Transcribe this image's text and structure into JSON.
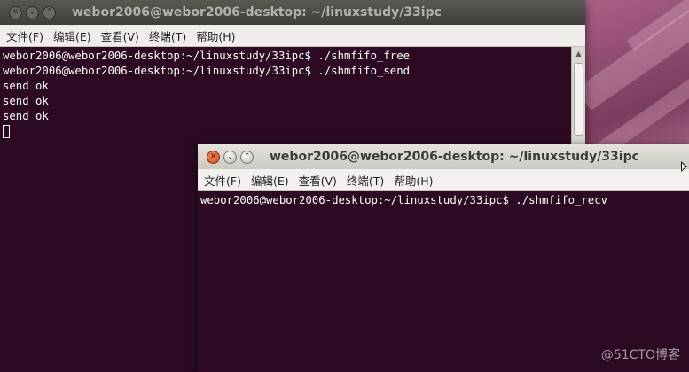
{
  "window1": {
    "title": "webor2006@webor2006-desktop: ~/linuxstudy/33ipc",
    "controls": {
      "close": "✕",
      "minimize": "⌄",
      "maximize": "⌃"
    },
    "menu": [
      "文件(F)",
      "编辑(E)",
      "查看(V)",
      "终端(T)",
      "帮助(H)"
    ],
    "lines": [
      "webor2006@webor2006-desktop:~/linuxstudy/33ipc$ ./shmfifo_free",
      "webor2006@webor2006-desktop:~/linuxstudy/33ipc$ ./shmfifo_send",
      "send ok",
      "send ok",
      "send ok"
    ]
  },
  "window2": {
    "title": "webor2006@webor2006-desktop: ~/linuxstudy/33ipc",
    "controls": {
      "close": "✕",
      "minimize": "⌄",
      "maximize": "⌃"
    },
    "menu": [
      "文件(F)",
      "编辑(E)",
      "查看(V)",
      "终端(T)",
      "帮助(H)"
    ],
    "lines": [
      "webor2006@webor2006-desktop:~/linuxstudy/33ipc$ ./shmfifo_recv"
    ]
  },
  "watermark": "@51CTO博客"
}
